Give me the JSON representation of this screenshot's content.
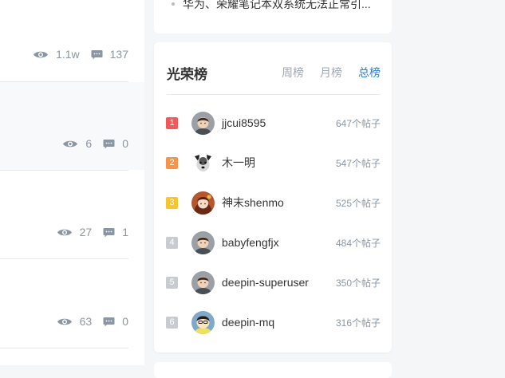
{
  "posts": [
    {
      "views": "1.1w",
      "comments": "137"
    },
    {
      "views": "6",
      "comments": "0"
    },
    {
      "views": "27",
      "comments": "1"
    },
    {
      "views": "63",
      "comments": "0"
    }
  ],
  "top_list": {
    "item_text": "华为、荣耀笔记本双系统无法正常引..."
  },
  "ranking": {
    "title": "光荣榜",
    "tabs": [
      {
        "label": "周榜",
        "active": false
      },
      {
        "label": "月榜",
        "active": false
      },
      {
        "label": "总榜",
        "active": true
      }
    ],
    "rows": [
      {
        "rank": "1",
        "badge_color": "#f25858",
        "username": "jjcui8595",
        "posts": "647个帖子",
        "avatar": "man"
      },
      {
        "rank": "2",
        "badge_color": "#f5944a",
        "username": "木一明",
        "posts": "547个帖子",
        "avatar": "dog"
      },
      {
        "rank": "3",
        "badge_color": "#f7c531",
        "username": "神末shenmo",
        "posts": "525个帖子",
        "avatar": "girl"
      },
      {
        "rank": "4",
        "badge_color": "#c8cbcf",
        "username": "babyfengfjx",
        "posts": "484个帖子",
        "avatar": "man"
      },
      {
        "rank": "5",
        "badge_color": "#c8cbcf",
        "username": "deepin-superuser",
        "posts": "350个帖子",
        "avatar": "man"
      },
      {
        "rank": "6",
        "badge_color": "#c8cbcf",
        "username": "deepin-mq",
        "posts": "316个帖子",
        "avatar": "cartoon"
      }
    ]
  },
  "icons": {
    "views": "eye-icon",
    "comments": "comment-icon"
  }
}
